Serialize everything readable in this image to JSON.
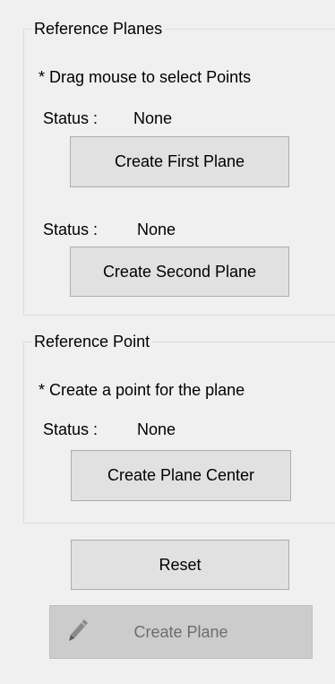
{
  "reference_planes": {
    "title": "Reference Planes",
    "hint": "* Drag mouse to select Points",
    "first": {
      "status_label": "Status :",
      "status_value": "None",
      "button_label": "Create First Plane"
    },
    "second": {
      "status_label": "Status :",
      "status_value": "None",
      "button_label": "Create Second Plane"
    }
  },
  "reference_point": {
    "title": "Reference Point",
    "hint": "* Create a point for the plane",
    "status_label": "Status :",
    "status_value": "None",
    "button_label": "Create Plane Center"
  },
  "actions": {
    "reset_label": "Reset",
    "create_plane_label": "Create Plane",
    "create_plane_icon": "pencil-icon",
    "create_plane_enabled": false
  }
}
